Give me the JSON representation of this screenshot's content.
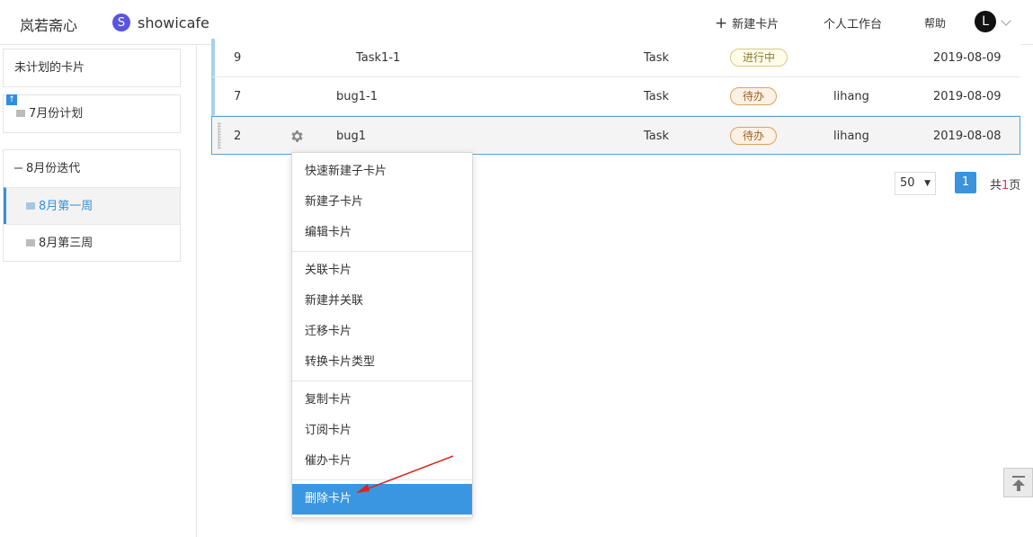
{
  "header": {
    "brand": "岚若斋心",
    "project_badge": "S",
    "project_name": "showicafe",
    "new_card_plus": "+",
    "new_card": "新建卡片",
    "workspace": "个人工作台",
    "help": "帮助",
    "avatar_letter": "L"
  },
  "sidebar": {
    "unplanned": "未计划的卡片",
    "july_plan": "7月份计划",
    "aug_iteration": "8月份迭代",
    "aug_week1": "8月第一周",
    "aug_week3": "8月第三周"
  },
  "rows": [
    {
      "id": "9",
      "title": "Task1-1",
      "type": "Task",
      "status": "进行中",
      "owner": "",
      "date": "2019-08-09"
    },
    {
      "id": "7",
      "title": "bug1-1",
      "type": "Task",
      "status": "待办",
      "owner": "lihang",
      "date": "2019-08-09"
    },
    {
      "id": "2",
      "title": "bug1",
      "type": "Task",
      "status": "待办",
      "owner": "lihang",
      "date": "2019-08-08"
    }
  ],
  "pager": {
    "page_size": "50",
    "current_page": "1",
    "total_prefix": "共",
    "total_pages": "1",
    "total_suffix": "页"
  },
  "menu": {
    "quick_new_child": "快速新建子卡片",
    "new_child": "新建子卡片",
    "edit": "编辑卡片",
    "link": "关联卡片",
    "new_and_link": "新建并关联",
    "migrate": "迁移卡片",
    "convert_type": "转换卡片类型",
    "copy": "复制卡片",
    "subscribe": "订阅卡片",
    "urge": "催办卡片",
    "delete": "删除卡片"
  },
  "colors": {
    "accent": "#3a96e0",
    "project_badge": "#5a55e0",
    "annotation_arrow": "#d9261c"
  },
  "icons": [
    "plus-icon",
    "chevron-down-icon",
    "folder-icon",
    "upload-icon",
    "collapse-icon",
    "gear-icon",
    "drag-handle-icon",
    "back-to-top-icon"
  ]
}
